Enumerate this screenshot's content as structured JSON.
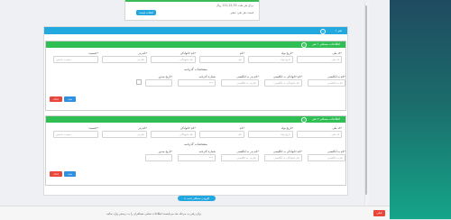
{
  "top_card": {
    "line1": "برای هر ملت 111,22,33 ریال",
    "line2": "قیمت هر نفر: صفر",
    "button": "انتخاب قیمت"
  },
  "outer": {
    "title": "نفر ۱",
    "icon": "info-circle-icon"
  },
  "passengers": [
    {
      "title": "اطلاعات مسافر ۱ نفر",
      "fields": [
        {
          "label": "کد ملی*",
          "placeholder": "کد ملی"
        },
        {
          "label": "تاریخ تولد*",
          "placeholder": "تاریخ تولد"
        },
        {
          "label": "نام*",
          "placeholder": "نام"
        },
        {
          "label": "نام خانوادگی*",
          "placeholder": "نام خانوادگی"
        },
        {
          "label": "نام پدر*",
          "placeholder": "نام پدر"
        },
        {
          "label": "جنسیت*",
          "placeholder": "جنسیت نامعین"
        }
      ],
      "passport_title": "مشخصات گذرنامه",
      "passport_fields": [
        {
          "label": "نام به انگلیسی*",
          "placeholder": "نام به انگلیسی"
        },
        {
          "label": "نام خانوادگی به انگلیسی*",
          "placeholder": "نام خانوادگی به انگلیسی"
        },
        {
          "label": "نام پدر به انگلیسی*",
          "placeholder": "نام پدر به انگلیسی"
        },
        {
          "label": "شماره گذرنامه",
          "placeholder": "***"
        },
        {
          "label": "تاریخ صدور*",
          "placeholder": ""
        }
      ],
      "delete_label": "حذف",
      "save_label": "ثبت"
    },
    {
      "title": "اطلاعات مسافر ۲ نفر",
      "fields": [
        {
          "label": "کد ملی*",
          "placeholder": "کد ملی"
        },
        {
          "label": "تاریخ تولد*",
          "placeholder": "تاریخ تولد"
        },
        {
          "label": "نام*",
          "placeholder": "نام"
        },
        {
          "label": "نام خانوادگی*",
          "placeholder": "نام خانوادگی"
        },
        {
          "label": "نام پدر*",
          "placeholder": "نام پدر"
        },
        {
          "label": "جنسیت*",
          "placeholder": "جنسیت نامعین"
        }
      ],
      "passport_title": "مشخصات گذرنامه",
      "passport_fields": [
        {
          "label": "نام به انگلیسی*",
          "placeholder": "نام به انگلیسی"
        },
        {
          "label": "نام خانوادگی به انگلیسی*",
          "placeholder": "نام خانوادگی به انگلیسی"
        },
        {
          "label": "نام پدر به انگلیسی*",
          "placeholder": "نام پدر به انگلیسی"
        },
        {
          "label": "شماره گذرنامه",
          "placeholder": "***"
        },
        {
          "label": "تاریخ صدور*",
          "placeholder": ""
        }
      ],
      "delete_label": "حذف",
      "save_label": "ثبت"
    }
  ],
  "add_passenger_label": "+ افزودن مسافر جدید",
  "footer": {
    "notice": "برای رفتن به مرحله بعد می‌بایست اطلاعات تمامی مسافران را به درستی وارد نمائید",
    "button": "قبلی"
  },
  "colors": {
    "green": "#2fbf54",
    "blue": "#22a7df",
    "red": "#e9473b"
  }
}
